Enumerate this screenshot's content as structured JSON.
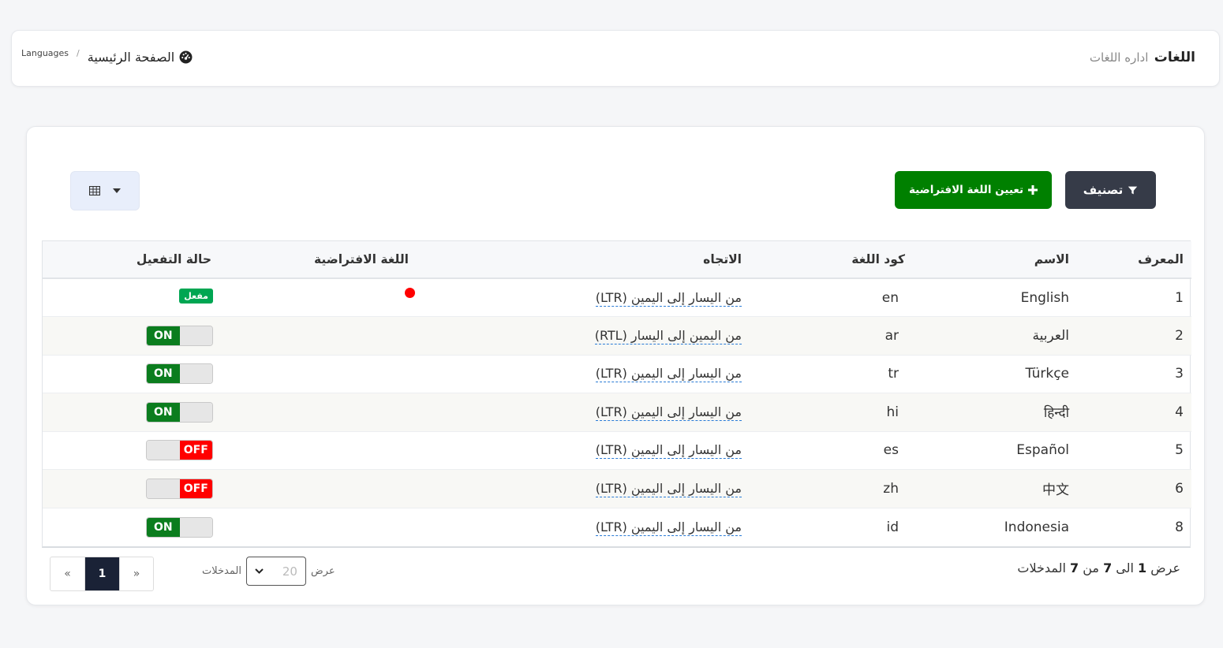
{
  "header": {
    "title": "اللغات",
    "subtitle": "اداره اللغات",
    "breadcrumb": {
      "home": "الصفحة الرئيسية",
      "separator": "/",
      "current": "Languages"
    }
  },
  "toolbar": {
    "filter_label": "تصنيف",
    "set_default_label": "تعيين اللغة الافتراضية",
    "icons": {
      "filter": "filter-icon",
      "plus": "plus-icon",
      "grid": "table-grid-icon",
      "caret": "caret-down-icon"
    }
  },
  "table": {
    "columns": [
      "المعرف",
      "الاسم",
      "كود اللغة",
      "الاتجاه",
      "اللغة الافتراضية",
      "حالة التفعيل"
    ],
    "rows": [
      {
        "id": "1",
        "name": "English",
        "code": "en",
        "direction": "من اليسار إلى اليمين (LTR)",
        "is_default": true,
        "status": "مفعل"
      },
      {
        "id": "2",
        "name": "العربية",
        "code": "ar",
        "direction": "من اليمين إلى اليسار (RTL)",
        "is_default": false,
        "status": "ON"
      },
      {
        "id": "3",
        "name": "Türkçe",
        "code": "tr",
        "direction": "من اليسار إلى اليمين (LTR)",
        "is_default": false,
        "status": "ON"
      },
      {
        "id": "4",
        "name": "हिन्दी",
        "code": "hi",
        "direction": "من اليسار إلى اليمين (LTR)",
        "is_default": false,
        "status": "ON"
      },
      {
        "id": "5",
        "name": "Español",
        "code": "es",
        "direction": "من اليسار إلى اليمين (LTR)",
        "is_default": false,
        "status": "OFF"
      },
      {
        "id": "6",
        "name": "中文",
        "code": "zh",
        "direction": "من اليسار إلى اليمين (LTR)",
        "is_default": false,
        "status": "OFF"
      },
      {
        "id": "8",
        "name": "Indonesia",
        "code": "id",
        "direction": "من اليسار إلى اليمين (LTR)",
        "is_default": false,
        "status": "ON"
      }
    ]
  },
  "footer": {
    "summary": {
      "prefix": "عرض",
      "from": "1",
      "to_word": "الى",
      "to": "7",
      "of_word": "من",
      "total": "7",
      "suffix": "المدخلات"
    },
    "per_page": {
      "label_before": "عرض",
      "value": "20",
      "label_after": "المدخلات"
    },
    "pagination": {
      "prev": "«",
      "current": "1",
      "next": "»"
    }
  },
  "colors": {
    "default_dot": "#ff0000",
    "active_badge": "#00a652",
    "toggle_on": "#0b7d1e",
    "toggle_off": "#ff0000",
    "filter_button": "#363b48",
    "default_button": "#008000"
  }
}
